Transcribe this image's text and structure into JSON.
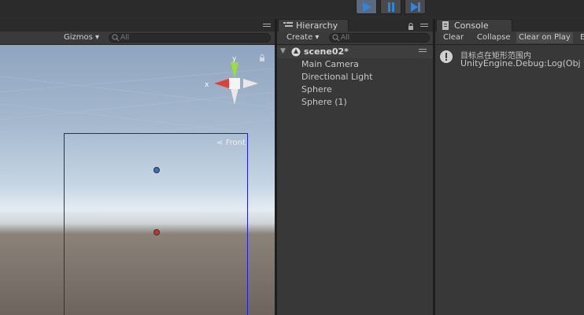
{
  "playbar": {
    "play": "play",
    "pause": "pause",
    "step": "step"
  },
  "scene": {
    "gizmos_label": "Gizmos",
    "search_placeholder": "All",
    "axis_y": "y",
    "axis_x": "x",
    "front_label": "Front"
  },
  "hierarchy": {
    "tab_label": "Hierarchy",
    "create_label": "Create",
    "search_placeholder": "All",
    "scene_name": "scene02*",
    "items": [
      "Main Camera",
      "Directional Light",
      "Sphere",
      "Sphere (1)"
    ]
  },
  "console": {
    "tab_label": "Console",
    "clear_label": "Clear",
    "collapse_label": "Collapse",
    "clear_on_play_label": "Clear on Play",
    "error_pause_label": "E",
    "entries": [
      {
        "message": "目标点在矩形范围内",
        "detail": "UnityEngine.Debug:Log(Obj"
      }
    ]
  },
  "colors": {
    "play_active": "#5a6a80",
    "selection_rect": "#1e1ed8",
    "sphere_blue": "#3a6ec0",
    "sphere_red": "#cc3030",
    "gizmo_x": "#e04030",
    "gizmo_y": "#9ae030"
  }
}
